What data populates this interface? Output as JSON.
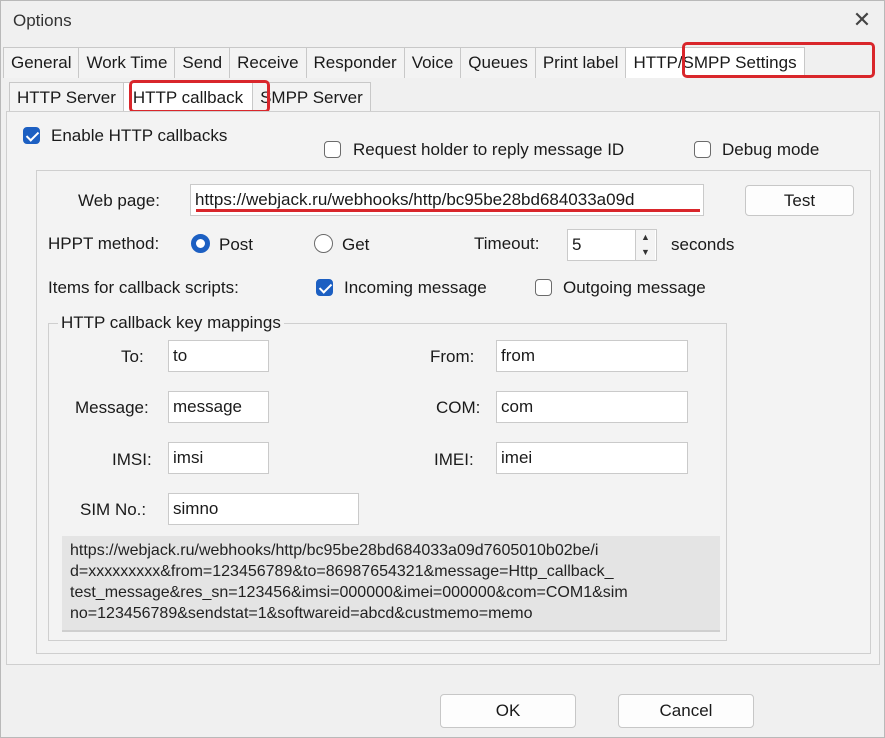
{
  "window": {
    "title": "Options",
    "close_glyph": "✕"
  },
  "main_tabs": [
    {
      "label": "General"
    },
    {
      "label": "Work Time"
    },
    {
      "label": "Send"
    },
    {
      "label": "Receive"
    },
    {
      "label": "Responder"
    },
    {
      "label": "Voice"
    },
    {
      "label": "Queues"
    },
    {
      "label": "Print label"
    },
    {
      "label": "HTTP/SMPP Settings",
      "active": true
    }
  ],
  "sub_tabs": [
    {
      "label": "HTTP Server"
    },
    {
      "label": "HTTP callback",
      "active": true
    },
    {
      "label": "SMPP Server"
    }
  ],
  "options": {
    "enable_callbacks": {
      "label": "Enable HTTP callbacks",
      "checked": true
    },
    "request_holder": {
      "label": "Request holder to reply message ID",
      "checked": false
    },
    "debug_mode": {
      "label": "Debug mode",
      "checked": false
    }
  },
  "web_page": {
    "label": "Web page:",
    "value": "https://webjack.ru/webhooks/http/bc95be28bd684033a09d",
    "test_button": "Test"
  },
  "method": {
    "label": "HPPT method:",
    "post": "Post",
    "get": "Get",
    "selected": "Post"
  },
  "timeout": {
    "label": "Timeout:",
    "value": "5",
    "unit": "seconds"
  },
  "items": {
    "label": "Items for callback scripts:",
    "incoming": {
      "label": "Incoming message",
      "checked": true
    },
    "outgoing": {
      "label": "Outgoing message",
      "checked": false
    }
  },
  "mappings": {
    "legend": "HTTP callback key mappings",
    "to": {
      "label": "To:",
      "value": "to"
    },
    "from": {
      "label": "From:",
      "value": "from"
    },
    "message": {
      "label": "Message:",
      "value": "message"
    },
    "com": {
      "label": "COM:",
      "value": "com"
    },
    "imsi": {
      "label": "IMSI:",
      "value": "imsi"
    },
    "imei": {
      "label": "IMEI:",
      "value": "imei"
    },
    "sim_no": {
      "label": "SIM No.:",
      "value": "simno"
    }
  },
  "preview_text": "https://webjack.ru/webhooks/http/bc95be28bd684033a09d7605010b02be/i\nd=xxxxxxxxx&from=123456789&to=86987654321&message=Http_callback_\ntest_message&res_sn=123456&imsi=000000&imei=000000&com=COM1&sim\nno=123456789&sendstat=1&softwareid=abcd&custmemo=memo",
  "footer": {
    "ok": "OK",
    "cancel": "Cancel"
  },
  "colors": {
    "accent": "#1c5fc2",
    "highlight": "#d9262b"
  }
}
